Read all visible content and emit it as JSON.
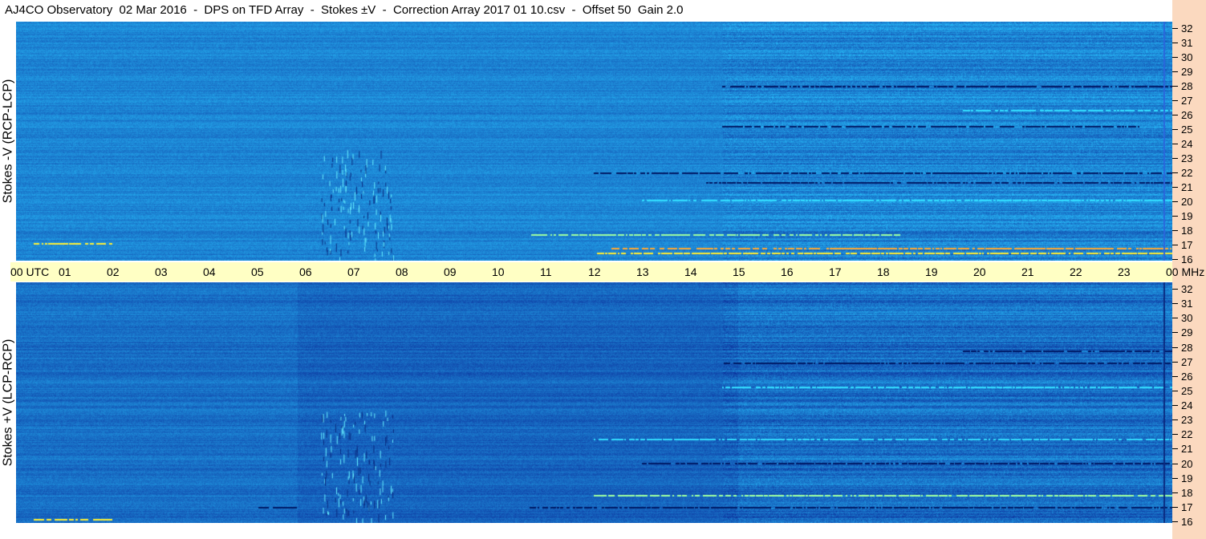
{
  "title": "AJ4CO Observatory  02 Mar 2016  -  DPS on TFD Array  -  Stokes ±V  -  Correction Array 2017 01 10.csv  -  Offset 50  Gain 2.0",
  "panels": {
    "top": {
      "label": "Stokes -V (RCP-LCP)"
    },
    "bottom": {
      "label": "Stokes +V (LCP-RCP)"
    }
  },
  "time_axis": {
    "ticks": [
      "00 UTC",
      "01",
      "02",
      "03",
      "04",
      "05",
      "06",
      "07",
      "08",
      "09",
      "10",
      "11",
      "12",
      "13",
      "14",
      "15",
      "16",
      "17",
      "18",
      "19",
      "20",
      "21",
      "22",
      "23",
      "00 MHz"
    ]
  },
  "freq_axis": {
    "ticks": [
      "32",
      "31",
      "30",
      "29",
      "28",
      "27",
      "26",
      "25",
      "24",
      "23",
      "22",
      "21",
      "20",
      "19",
      "18",
      "17",
      "16"
    ],
    "unit": "MHz"
  },
  "colors": {
    "background": "#ffffff",
    "time_bar": "#ffffc4",
    "freq_strip": "#fbd9bf",
    "spectrogram_base": "#1565d8"
  }
}
